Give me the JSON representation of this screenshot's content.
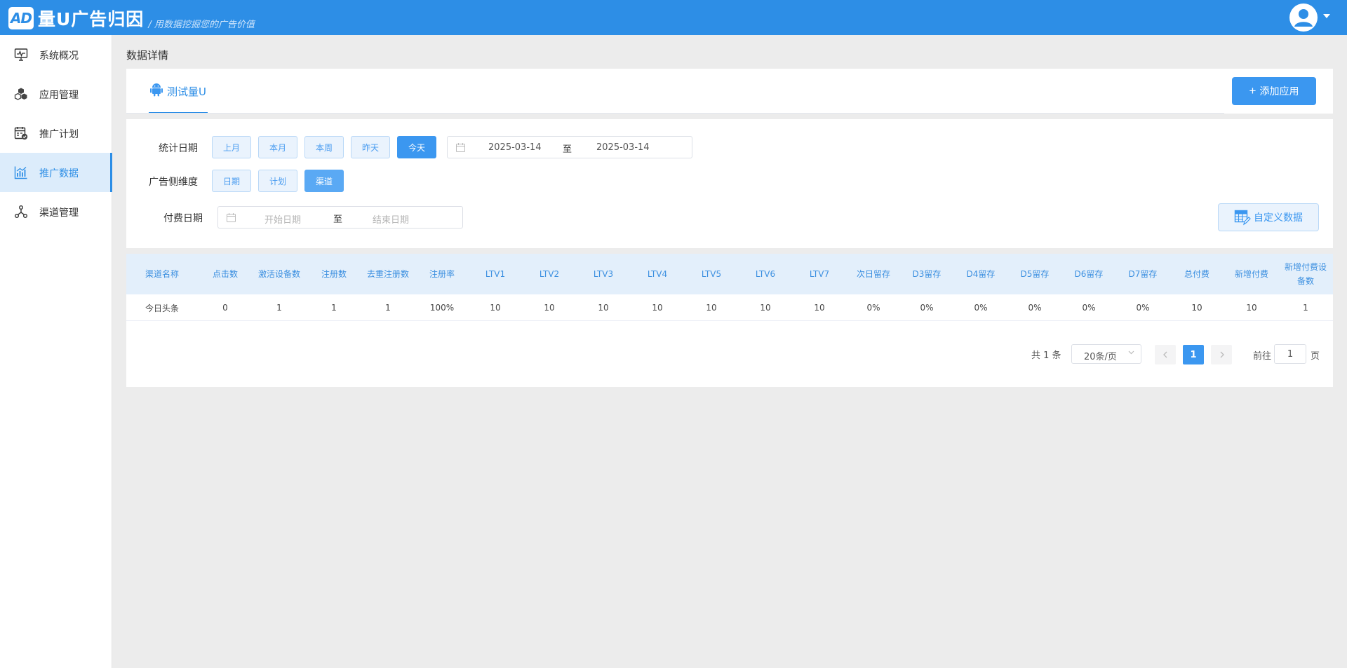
{
  "header": {
    "logo_mark": "AD",
    "app_name": "量U广告归因",
    "slogan": "/ 用数据挖掘您的广告价值",
    "brand_color": "#2d8ee6"
  },
  "sidebar": {
    "items": [
      {
        "label": "系统概况",
        "icon": "monitor-icon"
      },
      {
        "label": "应用管理",
        "icon": "cubes-icon"
      },
      {
        "label": "推广计划",
        "icon": "plan-calendar-icon"
      },
      {
        "label": "推广数据",
        "icon": "bar-chart-icon",
        "active": true
      },
      {
        "label": "渠道管理",
        "icon": "network-icon"
      }
    ]
  },
  "page": {
    "title": "数据详情"
  },
  "app_tabs": {
    "active_tab": "测试量U",
    "add_button": "添加应用"
  },
  "filters": {
    "stat_date_label": "统计日期",
    "stat_date_options": [
      "上月",
      "本月",
      "本周",
      "昨天",
      "今天"
    ],
    "stat_date_selected": "今天",
    "date_start": "2025-03-14",
    "date_separator": "至",
    "date_end": "2025-03-14",
    "dimension_label": "广告侧维度",
    "dimension_options": [
      "日期",
      "计划",
      "渠道"
    ],
    "dimension_selected": "渠道",
    "pay_date_label": "付费日期",
    "pay_start_placeholder": "开始日期",
    "pay_end_placeholder": "结束日期",
    "custom_button": "自定义数据"
  },
  "table": {
    "columns": [
      "渠道名称",
      "点击数",
      "激活设备数",
      "注册数",
      "去重注册数",
      "注册率",
      "LTV1",
      "LTV2",
      "LTV3",
      "LTV4",
      "LTV5",
      "LTV6",
      "LTV7",
      "次日留存",
      "D3留存",
      "D4留存",
      "D5留存",
      "D6留存",
      "D7留存",
      "总付费",
      "新增付费",
      "新增付费设备数"
    ],
    "rows": [
      [
        "今日头条",
        "0",
        "1",
        "1",
        "1",
        "100%",
        "10",
        "10",
        "10",
        "10",
        "10",
        "10",
        "10",
        "0%",
        "0%",
        "0%",
        "0%",
        "0%",
        "0%",
        "10",
        "10",
        "1"
      ]
    ]
  },
  "pagination": {
    "total_text": "共 1 条",
    "page_size": "20条/页",
    "current_page": "1",
    "goto_label": "前往",
    "goto_value": "1",
    "page_unit": "页"
  }
}
